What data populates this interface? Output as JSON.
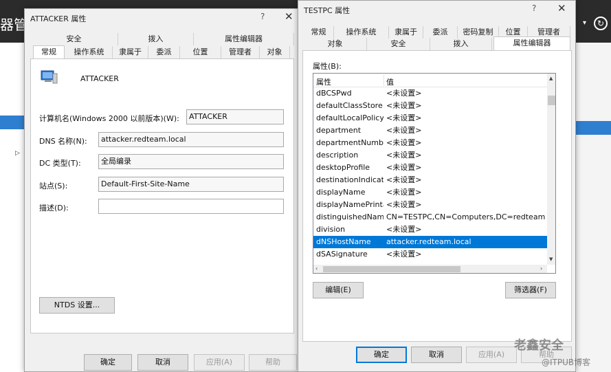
{
  "background": {
    "title_fragment": "器管"
  },
  "attacker_dialog": {
    "title": "ATTACKER 属性",
    "help": "?",
    "close": "✕",
    "tabs_row1": [
      "安全",
      "拨入",
      "属性编辑器"
    ],
    "tabs_row2": [
      "常规",
      "操作系统",
      "隶属于",
      "委派",
      "位置",
      "管理者",
      "对象"
    ],
    "computer_name": "ATTACKER",
    "fields": [
      {
        "label": "计算机名(Windows 2000 以前版本)(W):",
        "value": "ATTACKER"
      },
      {
        "label": "DNS 名称(N):",
        "value": "attacker.redteam.local"
      },
      {
        "label": "DC 类型(T):",
        "value": "全局编录"
      },
      {
        "label": "站点(S):",
        "value": "Default-First-Site-Name"
      },
      {
        "label": "描述(D):",
        "value": ""
      }
    ],
    "ntds_button": "NTDS 设置...",
    "buttons": {
      "ok": "确定",
      "cancel": "取消",
      "apply": "应用(A)",
      "help": "帮助"
    }
  },
  "testpc_dialog": {
    "title": "TESTPC 属性",
    "help": "?",
    "close": "✕",
    "tabs_row1": [
      "常规",
      "操作系统",
      "隶属于",
      "委派",
      "密码复制",
      "位置",
      "管理者"
    ],
    "tabs_row2": [
      "对象",
      "安全",
      "拨入",
      "属性编辑器"
    ],
    "attributes_label": "属性(B):",
    "columns": {
      "attr": "属性",
      "value": "值"
    },
    "rows": [
      {
        "attr": "dBCSPwd",
        "value": "<未设置>"
      },
      {
        "attr": "defaultClassStore",
        "value": "<未设置>"
      },
      {
        "attr": "defaultLocalPolicy...",
        "value": "<未设置>"
      },
      {
        "attr": "department",
        "value": "<未设置>"
      },
      {
        "attr": "departmentNumber",
        "value": "<未设置>"
      },
      {
        "attr": "description",
        "value": "<未设置>"
      },
      {
        "attr": "desktopProfile",
        "value": "<未设置>"
      },
      {
        "attr": "destinationIndicator",
        "value": "<未设置>"
      },
      {
        "attr": "displayName",
        "value": "<未设置>"
      },
      {
        "attr": "displayNamePrinta...",
        "value": "<未设置>"
      },
      {
        "attr": "distinguishedName",
        "value": "CN=TESTPC,CN=Computers,DC=redteam,DC=lo"
      },
      {
        "attr": "division",
        "value": "<未设置>"
      },
      {
        "attr": "dNSHostName",
        "value": "attacker.redteam.local",
        "selected": true
      },
      {
        "attr": "dSASignature",
        "value": "<未设置>"
      }
    ],
    "edit_button": "编辑(E)",
    "filter_button": "筛选器(F)",
    "buttons": {
      "ok": "确定",
      "cancel": "取消",
      "apply": "应用(A)",
      "help": "帮助"
    }
  },
  "watermark": {
    "line1": "老鑫安全",
    "line2": "@ITPUB博客"
  }
}
